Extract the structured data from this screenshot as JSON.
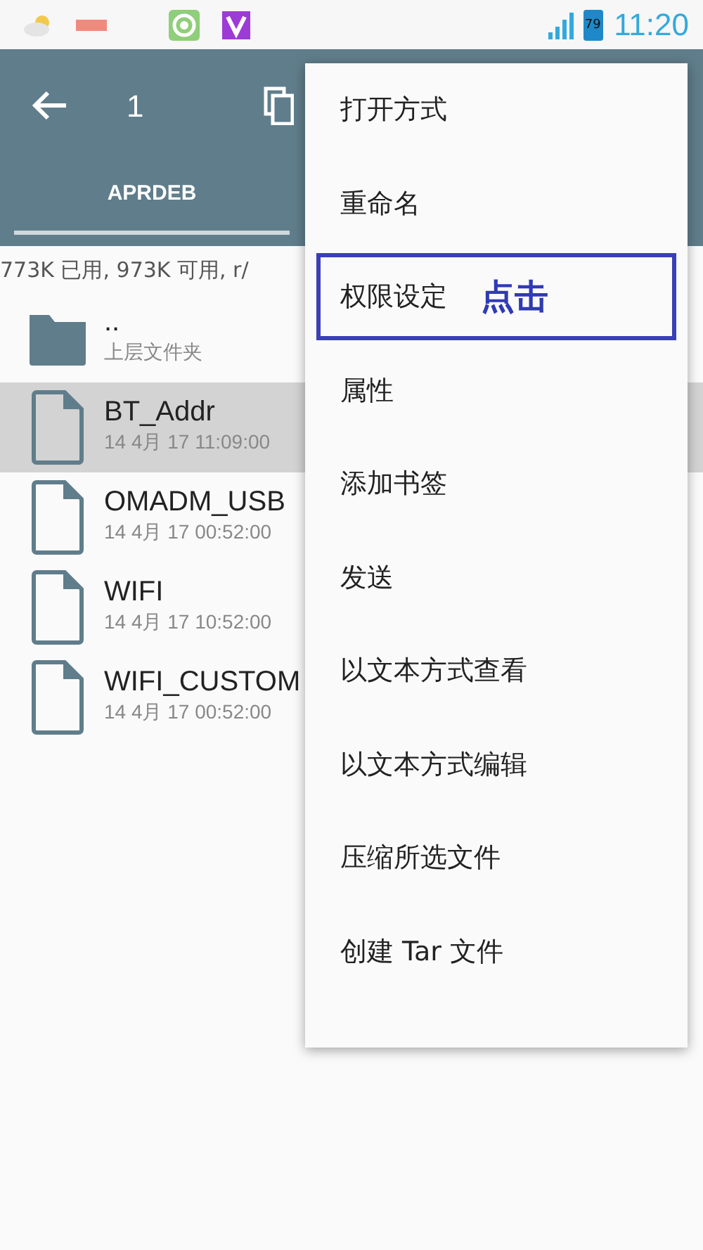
{
  "status_bar": {
    "battery": "79",
    "time": "11:20"
  },
  "toolbar": {
    "selection_count": "1"
  },
  "tabs": [
    {
      "label": "APRDEB",
      "selected": true
    }
  ],
  "storage_info": "773K 已用, 973K 可用, r/",
  "files": [
    {
      "kind": "folder",
      "name": "..",
      "detail": "上层文件夹",
      "selected": false
    },
    {
      "kind": "file",
      "name": "BT_Addr",
      "detail": "14 4月 17 11:09:00",
      "selected": true
    },
    {
      "kind": "file",
      "name": "OMADM_USB",
      "detail": "14 4月 17 00:52:00",
      "selected": false
    },
    {
      "kind": "file",
      "name": "WIFI",
      "detail": "14 4月 17 10:52:00",
      "selected": false
    },
    {
      "kind": "file",
      "name": "WIFI_CUSTOM",
      "detail": "14 4月 17 00:52:00",
      "selected": false
    }
  ],
  "menu": [
    {
      "label": "打开方式",
      "highlighted": false
    },
    {
      "label": "重命名",
      "highlighted": false
    },
    {
      "label": "权限设定",
      "highlighted": true,
      "callout": "点击"
    },
    {
      "label": "属性",
      "highlighted": false
    },
    {
      "label": "添加书签",
      "highlighted": false
    },
    {
      "label": "发送",
      "highlighted": false
    },
    {
      "label": "以文本方式查看",
      "highlighted": false
    },
    {
      "label": "以文本方式编辑",
      "highlighted": false
    },
    {
      "label": "压缩所选文件",
      "highlighted": false
    },
    {
      "label": "创建 Tar 文件",
      "highlighted": false
    }
  ]
}
